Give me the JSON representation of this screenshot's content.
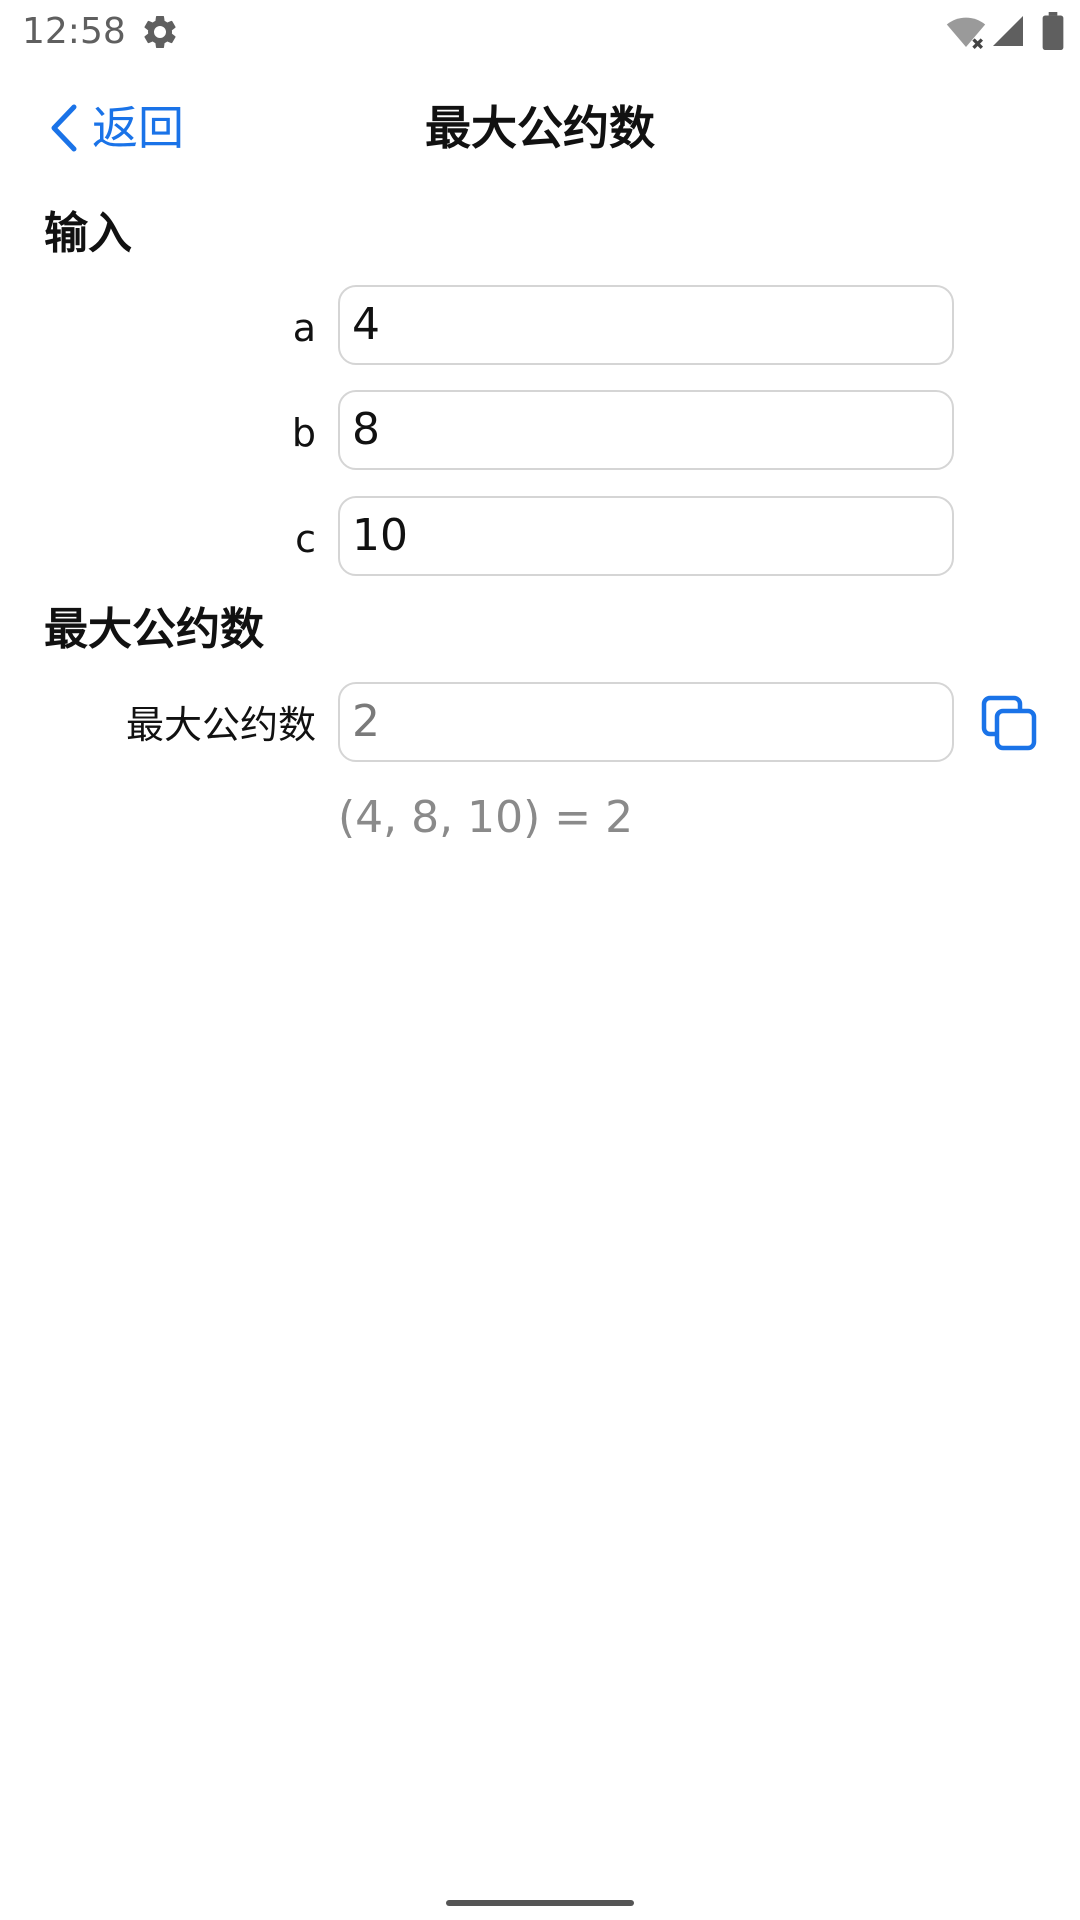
{
  "status_bar": {
    "time": "12:58",
    "icons": [
      "gear-icon",
      "wifi-off-icon",
      "signal-icon",
      "battery-icon"
    ]
  },
  "nav": {
    "back_label": "返回",
    "title": "最大公约数"
  },
  "input_section": {
    "title": "输入",
    "fields": [
      {
        "label": "a",
        "value": "4"
      },
      {
        "label": "b",
        "value": "8"
      },
      {
        "label": "c",
        "value": "10"
      }
    ]
  },
  "result_section": {
    "title": "最大公约数",
    "label": "最大公约数",
    "value": "2",
    "formula": "(4, 8, 10) = 2"
  },
  "colors": {
    "accent": "#1a73e8",
    "text": "#111111",
    "muted": "#8a8a8a",
    "border": "#d5d5d5"
  }
}
